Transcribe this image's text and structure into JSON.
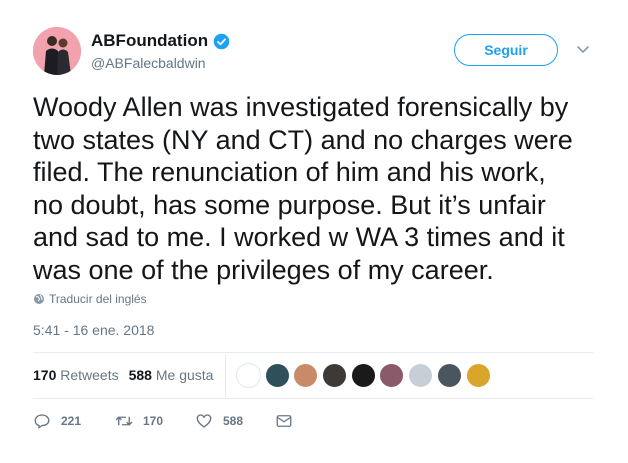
{
  "author": {
    "name": "ABFoundation",
    "handle": "@ABFalecbaldwin",
    "verified": true
  },
  "follow_button": {
    "label": "Seguir"
  },
  "tweet": {
    "lines": [
      "Woody Allen was investigated forensically by",
      "two states (NY and CT) and no charges were",
      "filed. The renunciation of him and his work,",
      "no doubt, has some purpose. But it’s unfair",
      "and sad to me. I worked w WA 3 times and it",
      "was one of the privileges of my career."
    ]
  },
  "translate_label": "Traducir del inglés",
  "timestamp": "5:41 - 16 ene. 2018",
  "stats": {
    "retweets_count": "170",
    "retweets_label": "Retweets",
    "likes_count": "588",
    "likes_label": "Me gusta"
  },
  "likers": [
    {
      "name": "liker-avatar-1",
      "color": "#ffffff"
    },
    {
      "name": "liker-avatar-2",
      "color": "#2f4f5a"
    },
    {
      "name": "liker-avatar-3",
      "color": "#c98a6a"
    },
    {
      "name": "liker-avatar-4",
      "color": "#3d3a36"
    },
    {
      "name": "liker-avatar-5",
      "color": "#1a1a1a"
    },
    {
      "name": "liker-avatar-6",
      "color": "#8a5a6a"
    },
    {
      "name": "liker-avatar-7",
      "color": "#c7cfd6"
    },
    {
      "name": "liker-avatar-8",
      "color": "#4b5560"
    },
    {
      "name": "liker-avatar-9",
      "color": "#d9a52a"
    }
  ],
  "actions": {
    "reply_count": "221",
    "retweet_count": "170",
    "like_count": "588"
  },
  "colors": {
    "accent": "#1da1f2",
    "muted": "#657786",
    "text": "#14171a",
    "avatar_bg": "#f1a2ac"
  }
}
